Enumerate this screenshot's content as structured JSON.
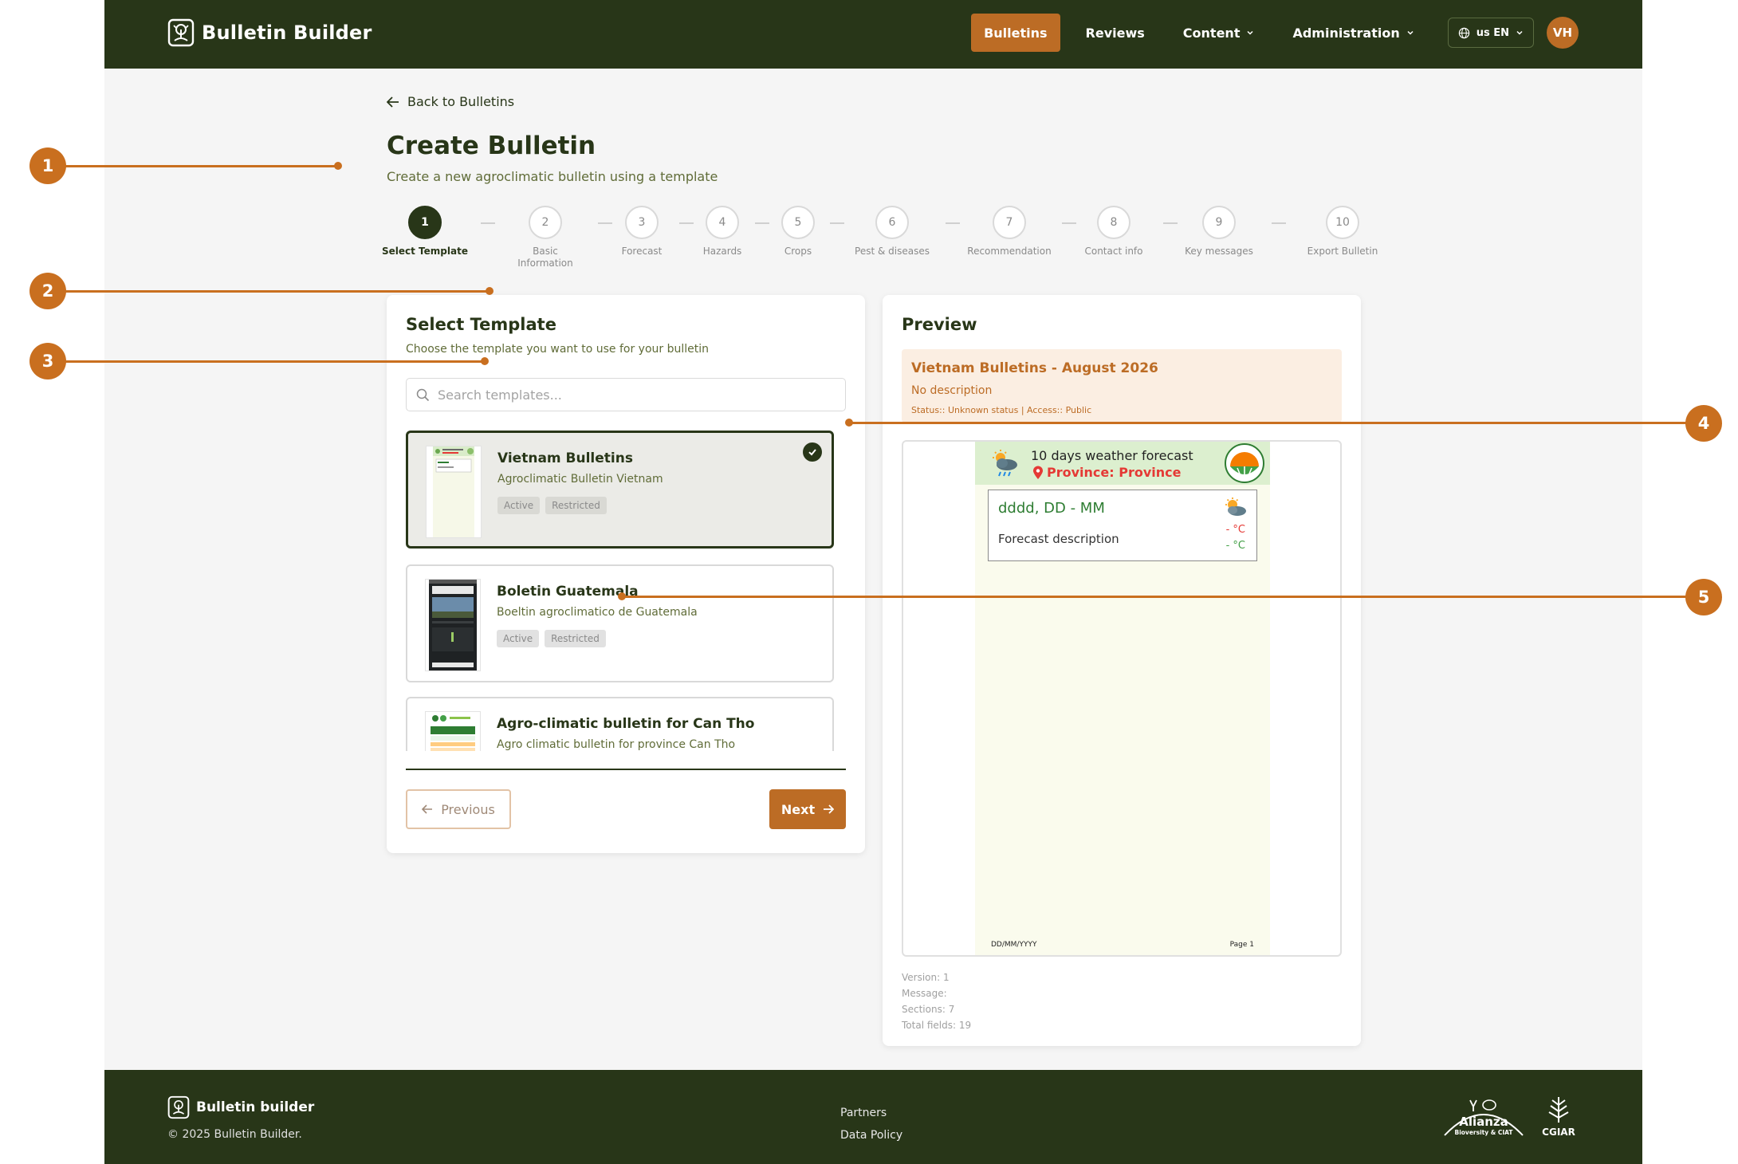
{
  "header": {
    "app_name": "Bulletin Builder",
    "nav": [
      {
        "label": "Bulletins",
        "active": true
      },
      {
        "label": "Reviews"
      },
      {
        "label": "Content"
      },
      {
        "label": "Administration"
      }
    ],
    "language": "us EN",
    "avatar_initials": "VH"
  },
  "page": {
    "back_label": "Back to Bulletins",
    "title": "Create Bulletin",
    "subtitle": "Create a new agroclimatic bulletin using a template"
  },
  "stepper": {
    "current": 1,
    "steps": [
      {
        "num": "1",
        "label": "Select Template"
      },
      {
        "num": "2",
        "label": "Basic Information"
      },
      {
        "num": "3",
        "label": "Forecast"
      },
      {
        "num": "4",
        "label": "Hazards"
      },
      {
        "num": "5",
        "label": "Crops"
      },
      {
        "num": "6",
        "label": "Pest & diseases"
      },
      {
        "num": "7",
        "label": "Recommendation"
      },
      {
        "num": "8",
        "label": "Contact info"
      },
      {
        "num": "9",
        "label": "Key messages"
      },
      {
        "num": "10",
        "label": "Export Bulletin"
      }
    ]
  },
  "select_template": {
    "title": "Select Template",
    "hint": "Choose the template you want to use for your bulletin",
    "search_placeholder": "Search templates...",
    "templates": [
      {
        "name": "Vietnam Bulletins",
        "description": "Agroclimatic Bulletin Vietnam",
        "badges": [
          "Active",
          "Restricted"
        ],
        "selected": true
      },
      {
        "name": "Boletin Guatemala",
        "description": "Boeltin agroclimatico de Guatemala",
        "badges": [
          "Active",
          "Restricted"
        ],
        "selected": false
      },
      {
        "name": "Agro-climatic bulletin for Can Tho",
        "description": "Agro climatic bulletin for province Can Tho",
        "badges": [],
        "selected": false
      }
    ],
    "previous_label": "Previous",
    "next_label": "Next"
  },
  "preview": {
    "title": "Preview",
    "bulletin_name": "Vietnam Bulletins - August 2026",
    "description": "No description",
    "status_line": "Status:: Unknown status | Access:: Public",
    "doc": {
      "heading": "10 days weather forecast",
      "province": "Province: Province",
      "date_placeholder": "dddd, DD - MM",
      "forecast_description": "Forecast description",
      "max_temp": "- °C",
      "min_temp": "- °C",
      "footer_date": "DD/MM/YYYY",
      "footer_page": "Page 1"
    },
    "stats": {
      "version": "Version: 1",
      "message": "Message:",
      "sections": "Sections: 7",
      "total_fields": "Total fields: 19"
    }
  },
  "footer": {
    "brand": "Bulletin builder",
    "copyright": "© 2025 Bulletin Builder.",
    "links": [
      "Partners",
      "Data Policy"
    ],
    "partner_alianza": "Alianza",
    "partner_alianza_sub": "Bioversity & CIAT",
    "partner_cgiar": "CGIAR"
  },
  "callouts": [
    "1",
    "2",
    "3",
    "4",
    "5"
  ],
  "colors": {
    "primary_dark": "#283618",
    "accent": "#bc6c25",
    "callout": "#c96f1f"
  }
}
